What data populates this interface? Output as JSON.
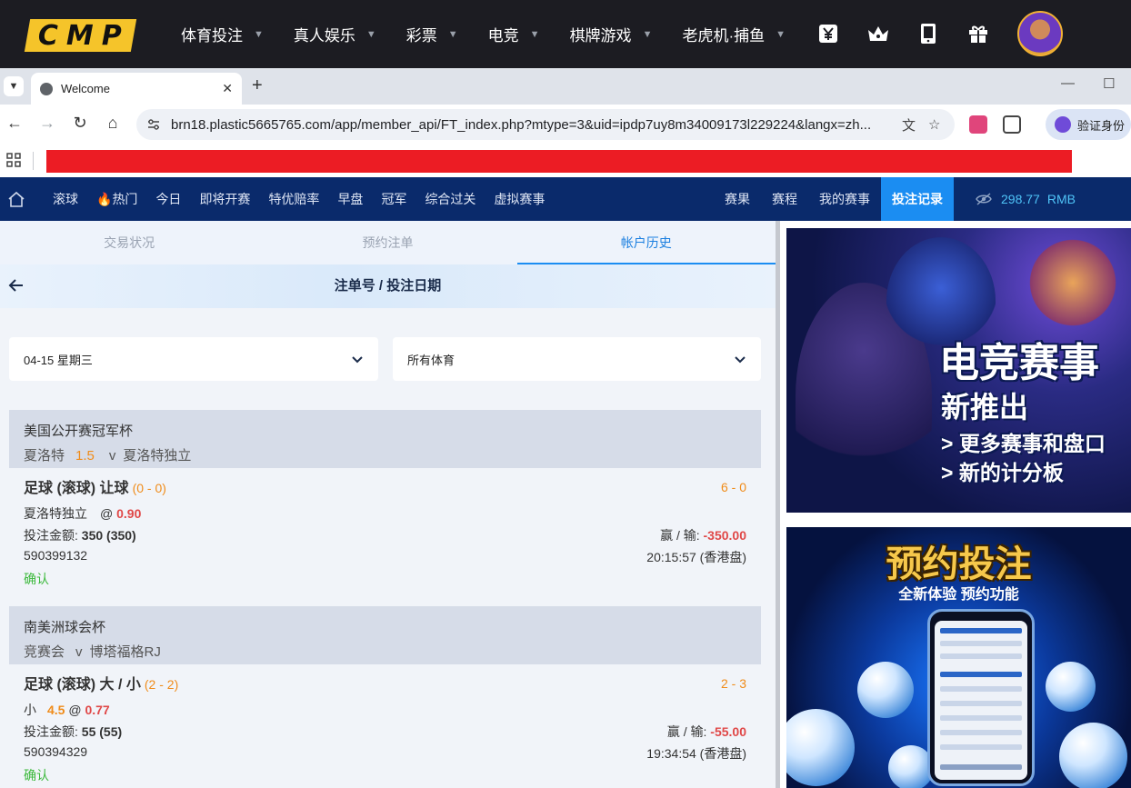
{
  "site": {
    "logo": "CMP",
    "nav": [
      {
        "label": "体育投注"
      },
      {
        "label": "真人娱乐"
      },
      {
        "label": "彩票"
      },
      {
        "label": "电竞"
      },
      {
        "label": "棋牌游戏"
      },
      {
        "label": "老虎机·捕鱼"
      }
    ],
    "icons": [
      "yen-icon",
      "crown-icon",
      "phone-icon",
      "gift-icon"
    ]
  },
  "browser": {
    "tab_title": "Welcome",
    "url": "brn18.plastic5665765.com/app/member_api/FT_index.php?mtype=3&uid=ipdp7uy8m34009173l229224&langx=zh...",
    "profile_label": "验证身份"
  },
  "sportsbook_nav": {
    "left": [
      "滚球",
      "热门",
      "今日",
      "即将开赛",
      "特优赔率",
      "早盘",
      "冠军",
      "综合过关",
      "虚拟赛事"
    ],
    "right": [
      "赛果",
      "赛程",
      "我的赛事"
    ],
    "active": "投注记录",
    "balance": "298.77",
    "currency": "RMB"
  },
  "sub_tabs": [
    {
      "label": "交易状况",
      "active": false
    },
    {
      "label": "预约注单",
      "active": false
    },
    {
      "label": "帐户历史",
      "active": true
    }
  ],
  "page_title": "注单号 / 投注日期",
  "filters": {
    "date": "04-15 星期三",
    "sport": "所有体育"
  },
  "bets": [
    {
      "league": "美国公开赛冠军杯",
      "home": "夏洛特",
      "handicap": "1.5",
      "vs": "v",
      "away": "夏洛特独立",
      "market": "足球 (滚球) 让球",
      "market_score": "(0 - 0)",
      "score": "6 - 0",
      "selection": "夏洛特独立",
      "selection_line": "",
      "at": "@",
      "odds": "0.90",
      "stake_label": "投注金额:",
      "stake": "350 (350)",
      "winloss_label": "赢 / 输:",
      "winloss": "-350.00",
      "bet_id": "590399132",
      "time": "20:15:57 (香港盘)",
      "status": "确认"
    },
    {
      "league": "南美洲球会杯",
      "home": "竞赛会",
      "handicap": "",
      "vs": "v",
      "away": "博塔福格RJ",
      "market": "足球 (滚球) 大 / 小",
      "market_score": "(2 - 2)",
      "score": "2 - 3",
      "selection": "小",
      "selection_line": "4.5",
      "at": "@",
      "odds": "0.77",
      "stake_label": "投注金额:",
      "stake": "55 (55)",
      "winloss_label": "赢 / 输:",
      "winloss": "-55.00",
      "bet_id": "590394329",
      "time": "19:34:54 (香港盘)",
      "status": "确认"
    }
  ],
  "banners": {
    "esports": {
      "title": "电竞赛事",
      "subtitle": "新推出",
      "bullets": [
        "> 更多赛事和盘口",
        "> 新的计分板"
      ]
    },
    "reservation": {
      "title": "预约投注",
      "subtitle": "全新体验 预约功能"
    }
  },
  "colors": {
    "site_bar": "#1c1c22",
    "logo_yellow": "#f5c42a",
    "sportsbook_nav": "#0a2a6b",
    "active_blue": "#1b8df2",
    "balance_cyan": "#4fc3f7",
    "orange": "#f08c1a",
    "loss_red": "#e04848",
    "confirm_green": "#3cb93c",
    "banner_red": "#ec1c24"
  }
}
